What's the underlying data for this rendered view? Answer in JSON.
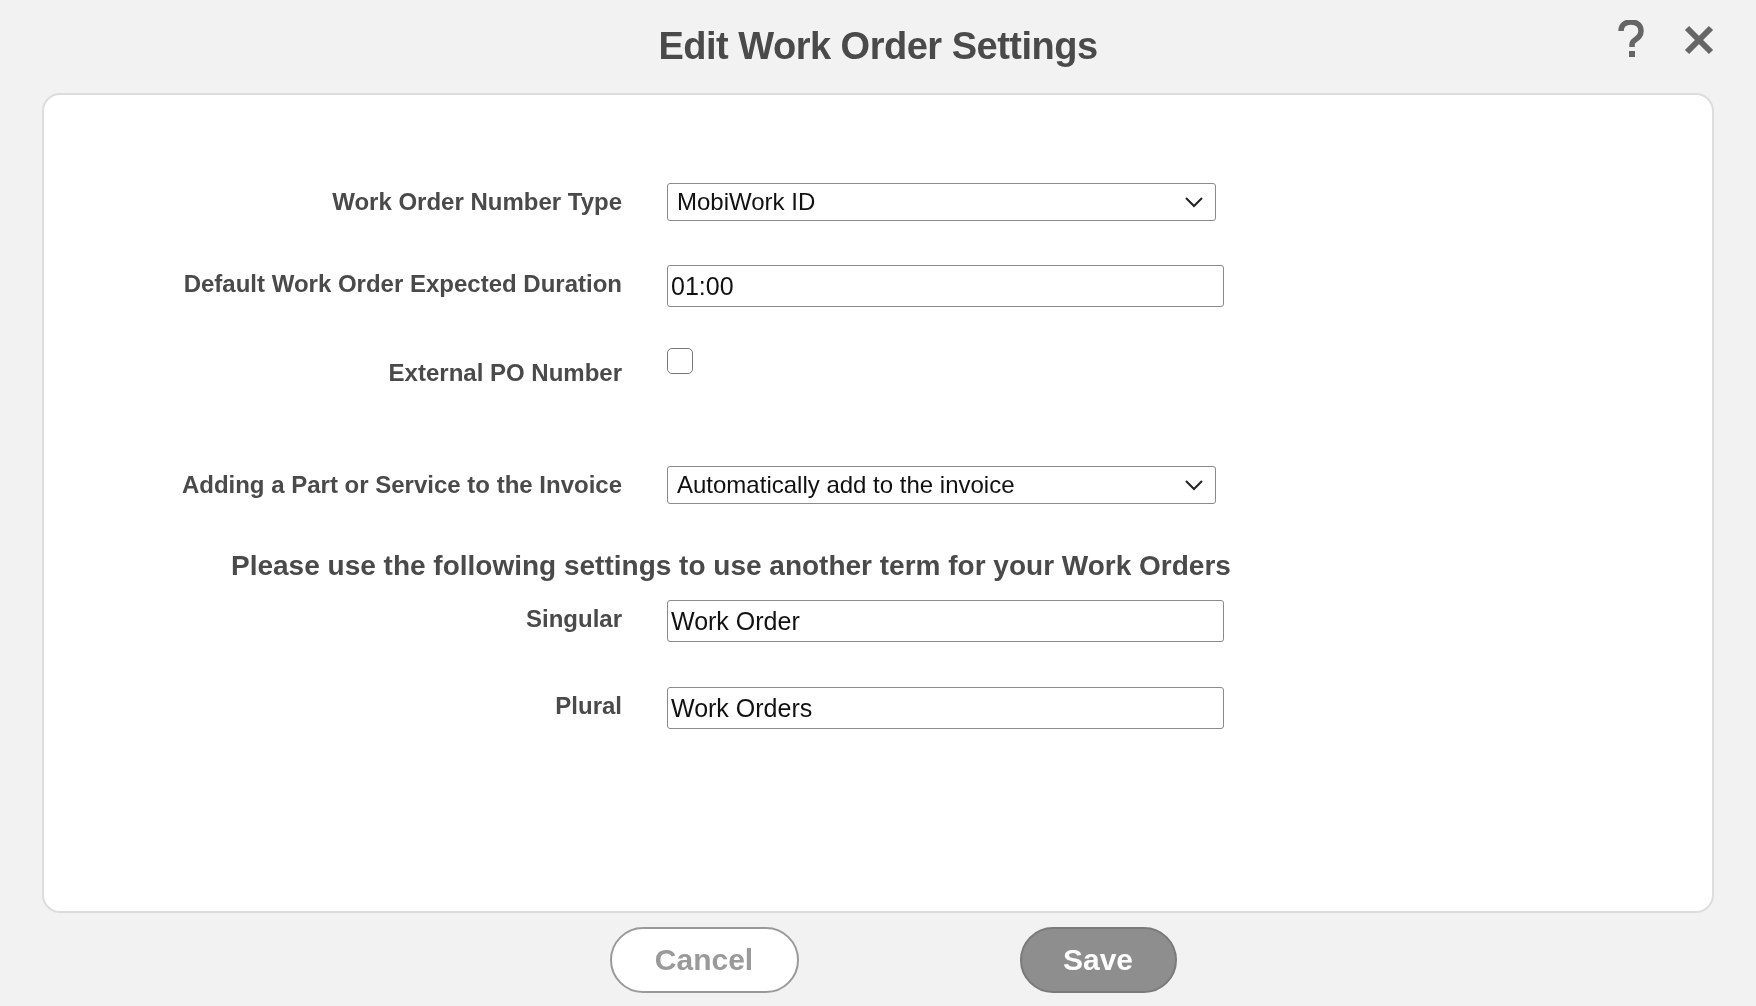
{
  "dialog": {
    "title": "Edit Work Order Settings"
  },
  "fields": [
    {
      "kind": "select",
      "label": "Work Order Number Type",
      "value": "MobiWork ID"
    },
    {
      "kind": "text",
      "label": "Default Work Order Expected Duration",
      "value": "01:00"
    },
    {
      "kind": "checkbox",
      "label": "External PO Number",
      "checked": false
    },
    {
      "kind": "select",
      "label": "Adding a Part or Service to the Invoice",
      "value": "Automatically add to the invoice"
    }
  ],
  "section_heading": "Please use the following settings to use another term for your Work Orders",
  "term_fields": [
    {
      "label": "Singular",
      "value": "Work Order"
    },
    {
      "label": "Plural",
      "value": "Work Orders"
    }
  ],
  "buttons": [
    {
      "label": "Cancel",
      "kind": "secondary"
    },
    {
      "label": "Save",
      "kind": "primary"
    }
  ]
}
